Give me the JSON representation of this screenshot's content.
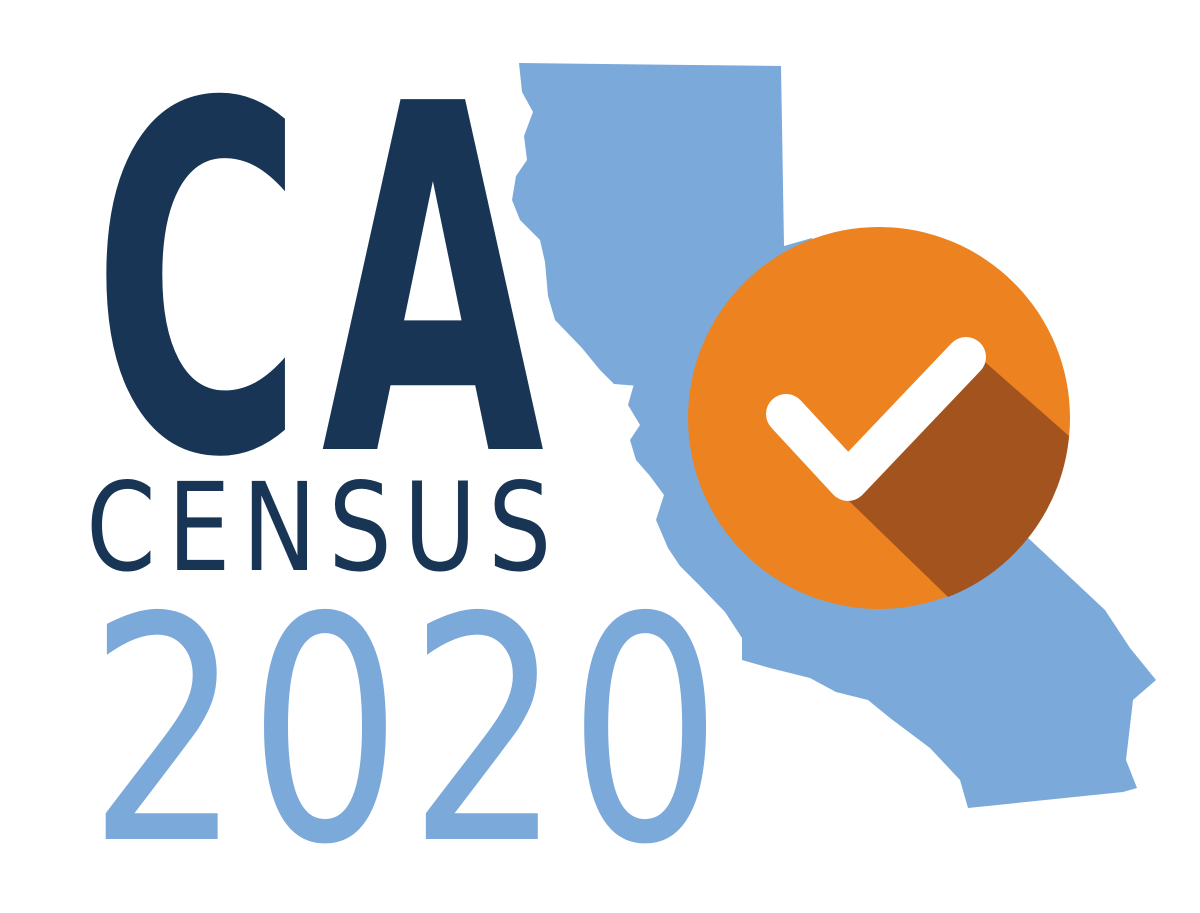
{
  "logo": {
    "line1": "CA",
    "line2": "CENSUS",
    "line3": "2020",
    "icons": {
      "state_shape": "california-map-icon",
      "badge": "checkmark-circle-icon"
    },
    "colors": {
      "navy": "#183555",
      "light_blue": "#7BA9DA",
      "orange": "#EC8320",
      "orange_shadow": "#A3541E",
      "white": "#FFFFFF"
    }
  }
}
